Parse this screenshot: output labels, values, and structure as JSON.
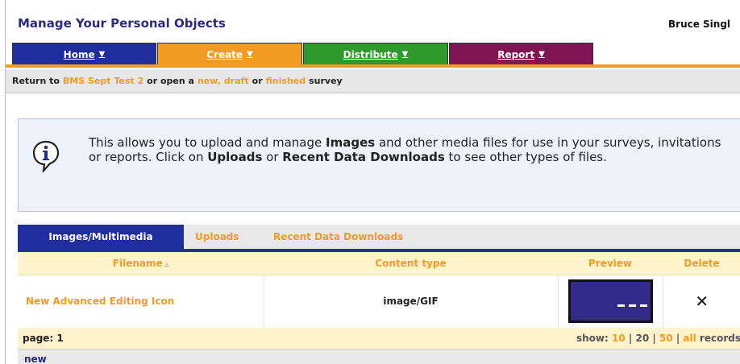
{
  "header": {
    "title": "Manage Your Personal Objects",
    "user": "Bruce Singl"
  },
  "nav": {
    "tabs": [
      {
        "label": "Home",
        "arrow": "▼",
        "color": "#1f2d9e"
      },
      {
        "label": "Create",
        "arrow": "▼",
        "color": "#f29b22"
      },
      {
        "label": "Distribute",
        "arrow": "▼",
        "color": "#2f9a2c"
      },
      {
        "label": "Report",
        "arrow": "▼",
        "color": "#7f1552"
      }
    ]
  },
  "returnbar": {
    "prefix": "Return to",
    "survey": "BMS Sept Test 2",
    "or_open": "or open a",
    "new": "new,",
    "draft": "draft",
    "or": "or",
    "finished": "finished",
    "suffix": "survey"
  },
  "info": {
    "icon": "info-icon",
    "text_1": "This allows you to upload and manage ",
    "images": "Images",
    "text_2": " and other media files for use in your surveys, invitations or reports. Click on ",
    "uploads": "Uploads",
    "text_3": " or ",
    "recent": "Recent Data Downloads",
    "text_4": " to see other types of files."
  },
  "subtabs": [
    "Images/Multimedia",
    "Uploads",
    "Recent Data Downloads"
  ],
  "table": {
    "headers": {
      "filename": "Filename",
      "sort_indicator": "▵",
      "content_type": "Content type",
      "preview": "Preview",
      "delete": "Delete"
    },
    "rows": [
      {
        "filename": "New Advanced Editing Icon",
        "content_type": "image/GIF",
        "delete": "✕"
      }
    ]
  },
  "pager": {
    "page_label": "page: 1",
    "show_label": "show:",
    "options": [
      "10",
      "20",
      "50",
      "all"
    ],
    "separator": "|",
    "records": "records"
  },
  "footer": {
    "new_label": "new"
  },
  "colors": {
    "accent": "#f29b22",
    "navy": "#1f2d9e",
    "title": "#2b2b7a"
  }
}
